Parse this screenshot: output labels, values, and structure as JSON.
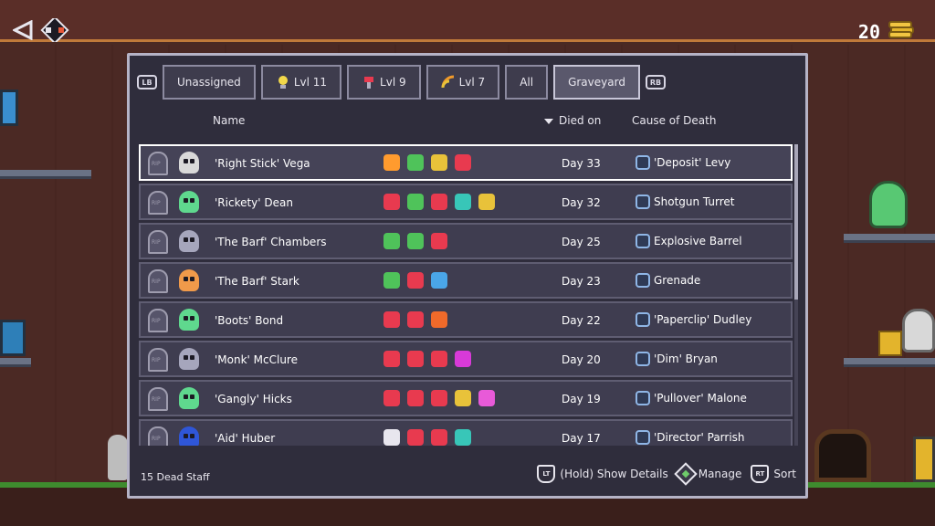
{
  "hud": {
    "coins": "20",
    "back_icon": "back-arrow-icon",
    "coin_icon": "coin-stack-icon"
  },
  "tabs": [
    {
      "label": "Unassigned",
      "icon": "",
      "active": false
    },
    {
      "label": "Lvl 11",
      "icon": "lightbulb-icon",
      "active": false
    },
    {
      "label": "Lvl 9",
      "icon": "wrench-icon",
      "active": false
    },
    {
      "label": "Lvl 7",
      "icon": "signal-icon",
      "active": false
    },
    {
      "label": "All",
      "icon": "",
      "active": false
    },
    {
      "label": "Graveyard",
      "icon": "",
      "active": true
    }
  ],
  "shoulder": {
    "left": "LB",
    "right": "RB"
  },
  "columns": {
    "name": "Name",
    "died_on": "Died on",
    "cause": "Cause of Death"
  },
  "staff": [
    {
      "name": "'Right Stick' Vega",
      "day": "Day 33",
      "cause": "'Deposit' Levy",
      "head_color": "#d9d9d9",
      "selected": true,
      "traits": [
        "#ff9b2e",
        "#4fc35a",
        "#e8c23a",
        "#e83a4f"
      ]
    },
    {
      "name": "'Rickety' Dean",
      "day": "Day 32",
      "cause": "Shotgun Turret",
      "head_color": "#5fd88e",
      "selected": false,
      "traits": [
        "#e83a4f",
        "#4fc35a",
        "#e83a4f",
        "#38c6b8",
        "#e8c23a"
      ]
    },
    {
      "name": "'The Barf' Chambers",
      "day": "Day 25",
      "cause": "Explosive Barrel",
      "head_color": "#a6a6bc",
      "selected": false,
      "traits": [
        "#4fc35a",
        "#4fc35a",
        "#e83a4f"
      ]
    },
    {
      "name": "'The Barf' Stark",
      "day": "Day 23",
      "cause": "Grenade",
      "head_color": "#f09a4a",
      "selected": false,
      "traits": [
        "#4fc35a",
        "#e83a4f",
        "#4aa6e8"
      ]
    },
    {
      "name": "'Boots' Bond",
      "day": "Day 22",
      "cause": "'Paperclip' Dudley",
      "head_color": "#5fd88e",
      "selected": false,
      "traits": [
        "#e83a4f",
        "#e83a4f",
        "#f06a2a"
      ]
    },
    {
      "name": "'Monk' McClure",
      "day": "Day 20",
      "cause": "'Dim' Bryan",
      "head_color": "#a6a6bc",
      "selected": false,
      "traits": [
        "#e83a4f",
        "#e83a4f",
        "#e83a4f",
        "#d83ad8"
      ]
    },
    {
      "name": "'Gangly' Hicks",
      "day": "Day 19",
      "cause": "'Pullover' Malone",
      "head_color": "#5fd88e",
      "selected": false,
      "traits": [
        "#e83a4f",
        "#e83a4f",
        "#e83a4f",
        "#e8c23a",
        "#e85ad8"
      ]
    },
    {
      "name": "'Aid' Huber",
      "day": "Day 17",
      "cause": "'Director' Parrish",
      "head_color": "#2f56d8",
      "selected": false,
      "traits": [
        "#e8e6ee",
        "#e83a4f",
        "#e83a4f",
        "#38c6b8"
      ]
    }
  ],
  "footer": {
    "count": "15 Dead Staff",
    "details_key": "LT",
    "details_label": "(Hold) Show Details",
    "manage_label": "Manage",
    "sort_key": "RT",
    "sort_label": "Sort"
  },
  "colors": {
    "panel_bg": "#2f2d3c",
    "panel_border": "#b5b3c6",
    "row_bg": "#3f3d50",
    "selected_border": "#ffffff",
    "floor_green": "#3e8b2e"
  }
}
